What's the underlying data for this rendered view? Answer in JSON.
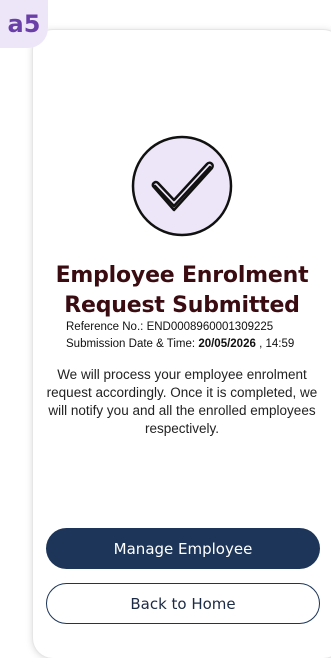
{
  "badge": {
    "label": "a5"
  },
  "icon": {
    "name": "check-circle-icon"
  },
  "confirmation": {
    "title_line1": "Employee Enrolment",
    "title_line2": "Request Submitted",
    "reference_label": "Reference No.:",
    "reference_value": "END0008960001309225",
    "date_label": "Submission Date & Time:",
    "date_value": "20/05/2026",
    "time_value": ", 14:59",
    "description": "We will process your employee enrolment request accordingly. Once it is completed, we will notify you and all the enrolled employees respectively."
  },
  "actions": {
    "manage_label": "Manage Employee",
    "home_label": "Back to Home"
  },
  "colors": {
    "primary": "#1c3558",
    "title": "#3a0c12",
    "badge_bg": "#ece6f8",
    "badge_text": "#6b3fa8",
    "icon_fill": "#ece6f8"
  }
}
